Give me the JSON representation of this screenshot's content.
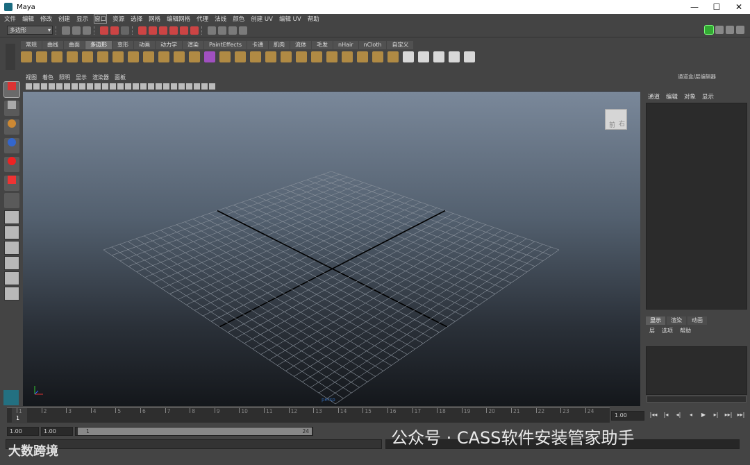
{
  "window": {
    "title": "Maya",
    "buttons": [
      "—",
      "☐",
      "✕"
    ]
  },
  "menu": [
    "文件",
    "编辑",
    "修改",
    "创建",
    "显示",
    "窗口",
    "资源",
    "选择",
    "网格",
    "编辑网格",
    "代理",
    "法线",
    "颜色",
    "创建 UV",
    "编辑 UV",
    "帮助"
  ],
  "status": {
    "mode": "多边形"
  },
  "shelf": {
    "tabs": [
      "常规",
      "曲线",
      "曲面",
      "多边形",
      "变形",
      "动画",
      "动力学",
      "渲染",
      "PaintEffects",
      "卡通",
      "肌肉",
      "流体",
      "毛发",
      "nHair",
      "nCloth",
      "自定义"
    ],
    "active_tab": "多边形"
  },
  "viewport": {
    "menu": [
      "视图",
      "着色",
      "照明",
      "显示",
      "渲染器",
      "面板"
    ],
    "viewcube": {
      "face1": "前",
      "face2": "右"
    },
    "camera_label": "persp"
  },
  "channel_box": {
    "header": "通道盒/层编辑器",
    "menu": [
      "通道",
      "编辑",
      "对象",
      "显示"
    ]
  },
  "layer_editor": {
    "tabs": [
      "显示",
      "渲染",
      "动画"
    ],
    "active_tab": "显示",
    "menu": [
      "层",
      "选项",
      "帮助"
    ]
  },
  "timeline": {
    "ticks": [
      "1",
      "2",
      "3",
      "4",
      "5",
      "6",
      "7",
      "8",
      "9",
      "10",
      "11",
      "12",
      "13",
      "14",
      "15",
      "16",
      "17",
      "18",
      "19",
      "20",
      "21",
      "22",
      "23",
      "24"
    ],
    "current_frame": "1",
    "current_field": "1.00"
  },
  "range": {
    "start": "1.00",
    "start2": "1.00",
    "handle_start": "1",
    "handle_end": "24"
  },
  "playback": [
    "|◂◂",
    "|◂",
    "◂|",
    "◂",
    "▶",
    "▸|",
    "▸▸|",
    "▸▸|"
  ],
  "overlay": {
    "left": "大数跨境",
    "right": "公众号 · CASS软件安装管家助手"
  },
  "colors": {
    "active_tab": "#6d6d6d",
    "viewport_top": "#7a889a",
    "viewport_bottom": "#14171b"
  }
}
